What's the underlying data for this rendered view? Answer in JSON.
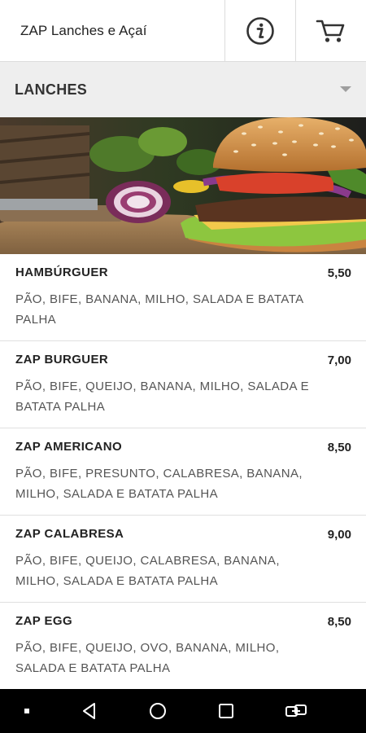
{
  "header": {
    "title": "ZAP Lanches e Açaí",
    "info_icon": "info-icon",
    "cart_icon": "cart-icon"
  },
  "section": {
    "title": "LANCHES",
    "dropdown_icon": "dropdown-arrow-icon"
  },
  "hero": {
    "image": "burger-photo"
  },
  "menu": {
    "items": [
      {
        "name": "HAMBÚRGUER",
        "price": "5,50",
        "description": "PÃO, BIFE, BANANA, MILHO, SALADA E BATATA PALHA"
      },
      {
        "name": "ZAP BURGUER",
        "price": "7,00",
        "description": "PÃO, BIFE, QUEIJO, BANANA, MILHO, SALADA E BATATA PALHA"
      },
      {
        "name": "ZAP AMERICANO",
        "price": "8,50",
        "description": "PÃO, BIFE, PRESUNTO, CALABRESA, BANANA, MILHO, SALADA E BATATA PALHA"
      },
      {
        "name": "ZAP CALABRESA",
        "price": "9,00",
        "description": "PÃO, BIFE, QUEIJO, CALABRESA, BANANA, MILHO, SALADA E BATATA PALHA"
      },
      {
        "name": "ZAP EGG",
        "price": "8,50",
        "description": "PÃO, BIFE, QUEIJO, OVO, BANANA, MILHO, SALADA E BATATA PALHA"
      }
    ]
  },
  "navbar": {
    "icons": [
      "menu-dot-icon",
      "back-icon",
      "home-icon",
      "recents-icon",
      "screen-switch-icon"
    ]
  },
  "colors": {
    "section_bg": "#eeeeee",
    "navbar_bg": "#000000",
    "divider": "#e0e0e0"
  }
}
